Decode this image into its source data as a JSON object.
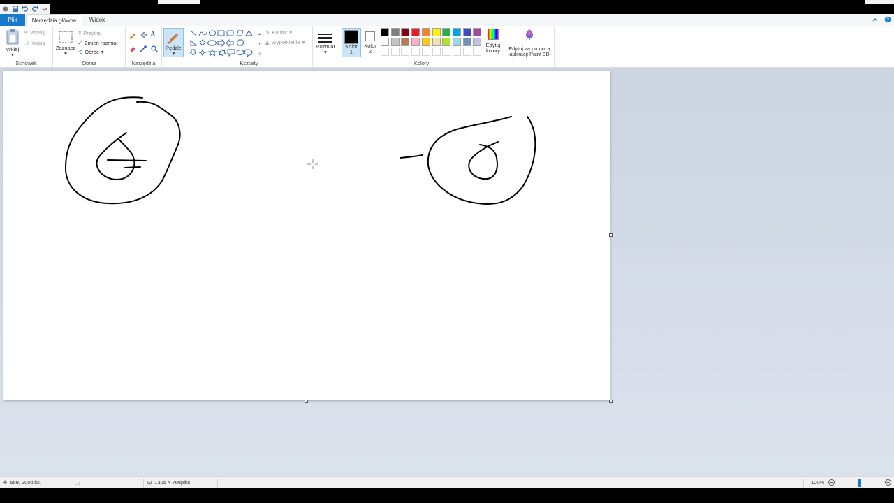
{
  "tabs": {
    "file": "Plik",
    "home": "Narzędzia główne",
    "view": "Widok"
  },
  "clipboard": {
    "paste": "Wklej",
    "cut": "Wytnij",
    "copy": "Kopiuj",
    "group": "Schowek"
  },
  "image": {
    "select": "Zaznacz",
    "crop": "Przytnij",
    "resize": "Zmień rozmiar",
    "rotate": "Obróć",
    "group": "Obraz"
  },
  "tools": {
    "group": "Narzędzia"
  },
  "brushes": {
    "label": "Pędzle"
  },
  "shapes": {
    "outline": "Kontur",
    "fill": "Wypełnienie",
    "group": "Kształty"
  },
  "size": {
    "label": "Rozmiar"
  },
  "colors": {
    "color1": "Kolor\n1",
    "color1_a": "Kolor",
    "color1_b": "1",
    "color2_a": "Kolor",
    "color2_b": "2",
    "edit_a": "Edytuj",
    "edit_b": "kolory",
    "group": "Kolory",
    "color1_value": "#000000",
    "color2_value": "#ffffff",
    "palette_row1": [
      "#000000",
      "#7f7f7f",
      "#880015",
      "#ed1c24",
      "#ff7f27",
      "#fff200",
      "#22b14c",
      "#00a2e8",
      "#3f48cc",
      "#a349a4"
    ],
    "palette_row2": [
      "#ffffff",
      "#c3c3c3",
      "#b97a57",
      "#ffaec9",
      "#ffc90e",
      "#efe4b0",
      "#b5e61d",
      "#99d9ea",
      "#7092be",
      "#c8bfe7"
    ]
  },
  "paint3d": {
    "line1": "Edytuj za pomocą",
    "line2": "aplikacji Paint 3D"
  },
  "status": {
    "position": "659, 200piks.",
    "dimensions": "1305 × 708piks.",
    "zoom": "100%"
  }
}
